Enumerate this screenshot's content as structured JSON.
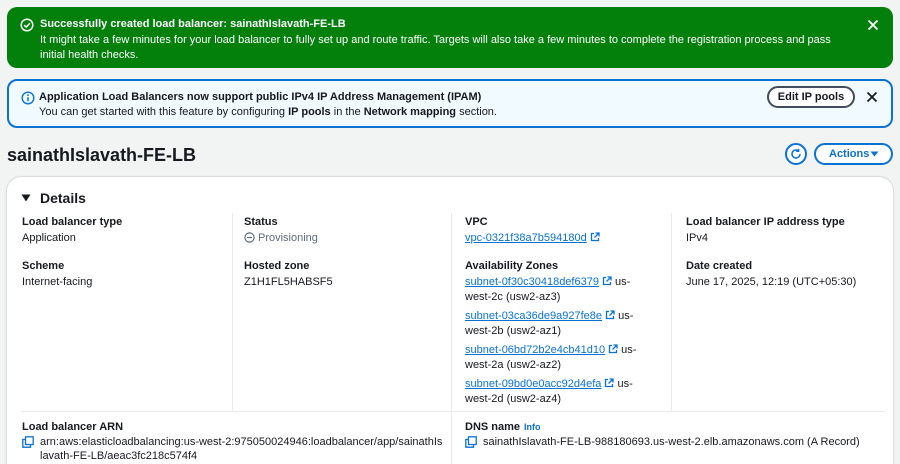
{
  "success_flash": {
    "title": "Successfully created load balancer: sainathIslavath-FE-LB",
    "body": "It might take a few minutes for your load balancer to fully set up and route traffic. Targets will also take a few minutes to complete the registration process and pass initial health checks."
  },
  "info_flash": {
    "title": "Application Load Balancers now support public IPv4 IP Address Management (IPAM)",
    "body_prefix": "You can get started with this feature by configuring ",
    "body_bold1": "IP pools",
    "body_middle": " in the ",
    "body_bold2": "Network mapping",
    "body_suffix": " section.",
    "button_label": "Edit IP pools"
  },
  "page": {
    "title": "sainathIslavath-FE-LB",
    "actions_label": "Actions"
  },
  "details": {
    "heading": "Details",
    "lb_type_label": "Load balancer type",
    "lb_type_value": "Application",
    "scheme_label": "Scheme",
    "scheme_value": "Internet-facing",
    "status_label": "Status",
    "status_value": "Provisioning",
    "hosted_zone_label": "Hosted zone",
    "hosted_zone_value": "Z1H1FL5HABSF5",
    "vpc_label": "VPC",
    "vpc_value": "vpc-0321f38a7b594180d",
    "az_label": "Availability Zones",
    "subnets": [
      {
        "id": "subnet-0f30c30418def6379",
        "zone": "us-west-2c (usw2-az3)"
      },
      {
        "id": "subnet-03ca36de9a927fe8e",
        "zone": "us-west-2b (usw2-az1)"
      },
      {
        "id": "subnet-06bd72b2e4cb41d10",
        "zone": "us-west-2a (usw2-az2)"
      },
      {
        "id": "subnet-09bd0e0acc92d4efa",
        "zone": "us-west-2d (usw2-az4)"
      }
    ],
    "ip_type_label": "Load balancer IP address type",
    "ip_type_value": "IPv4",
    "date_label": "Date created",
    "date_value": "June 17, 2025, 12:19 (UTC+05:30)",
    "arn_label": "Load balancer ARN",
    "arn_value": "arn:aws:elasticloadbalancing:us-west-2:975050024946:loadbalancer/app/sainathIslavath-FE-LB/aeac3fc218c574f4",
    "dns_label": "DNS name",
    "dns_info": "Info",
    "dns_value": "sainathIslavath-FE-LB-988180693.us-west-2.elb.amazonaws.com (A Record)"
  },
  "colors": {
    "success": "#037f0c",
    "info_border": "#0972d3",
    "link": "#0972d3"
  }
}
